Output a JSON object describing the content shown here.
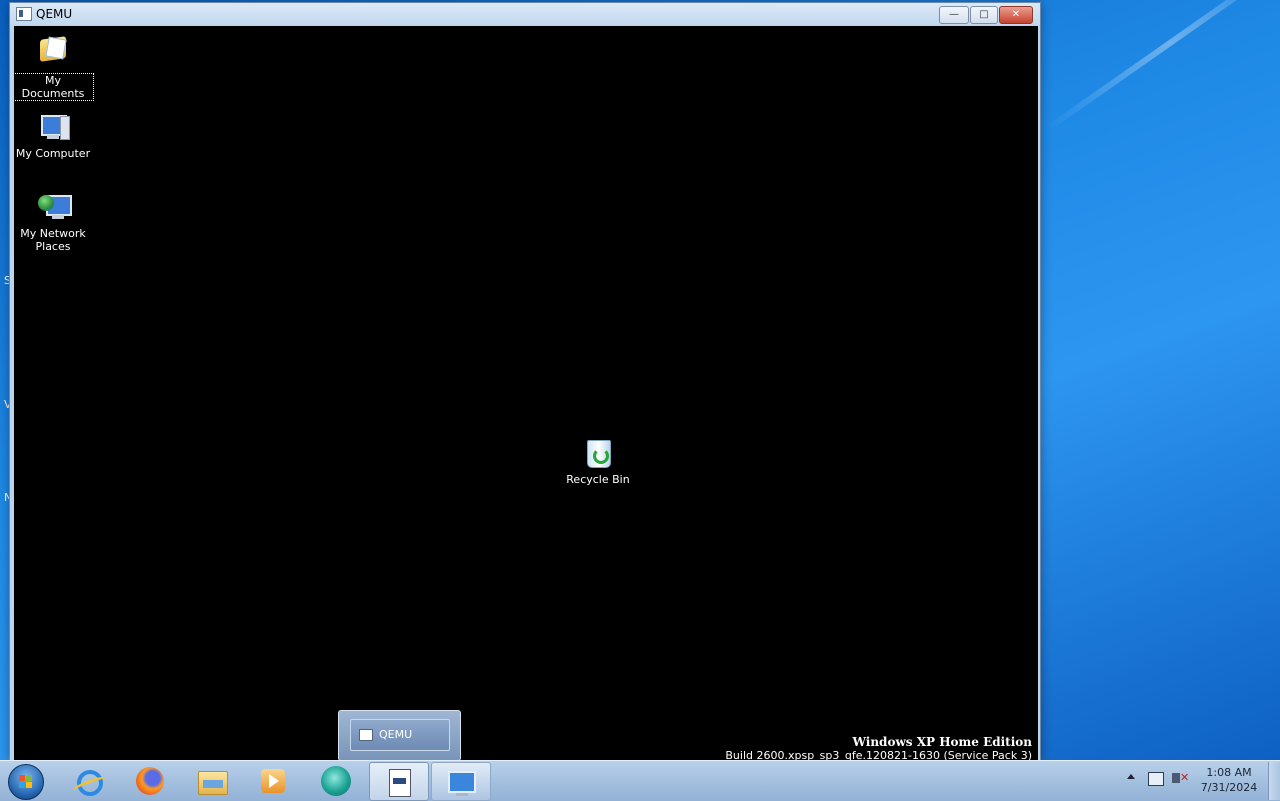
{
  "qemu_window": {
    "title": "QEMU",
    "controls": {
      "minimize": "—",
      "maximize": "□",
      "close": "✕"
    }
  },
  "guest_desktop": {
    "icons": [
      {
        "label": "My Documents",
        "icon": "my-documents-icon",
        "selected": true
      },
      {
        "label": "My Computer",
        "icon": "my-computer-icon"
      },
      {
        "label": "My Network Places",
        "icon": "my-network-places-icon"
      },
      {
        "label": "Recycle Bin",
        "icon": "recycle-bin-icon"
      }
    ],
    "branding": {
      "edition": "Windows XP Home Edition",
      "build": "Build 2600.xpsp_sp3_qfe.120821-1630 (Service Pack 3)"
    }
  },
  "host_desktop": {
    "edge_letters": [
      "S",
      "V",
      "N"
    ]
  },
  "taskbar_preview": {
    "label": "QEMU"
  },
  "taskbar": {
    "start_icon": "windows-start-orb",
    "pinned": [
      {
        "name": "internet-explorer-icon"
      },
      {
        "name": "firefox-icon"
      },
      {
        "name": "windows-explorer-icon"
      },
      {
        "name": "media-player-icon"
      },
      {
        "name": "teal-app-icon"
      },
      {
        "name": "document-app-icon"
      },
      {
        "name": "qemu-monitor-icon"
      }
    ],
    "clock": {
      "time": "1:08 AM",
      "date": "7/31/2024"
    },
    "tray_icons": [
      "show-hidden-icons-chevron",
      "network-icon",
      "volume-muted-icon"
    ]
  }
}
